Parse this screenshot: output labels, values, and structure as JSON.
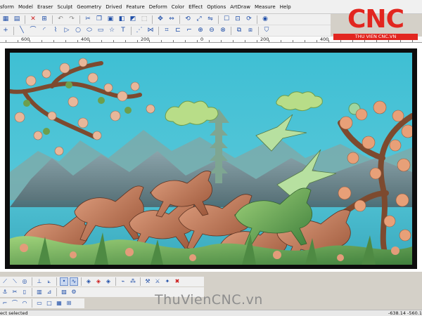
{
  "menu": [
    "sform",
    "Model",
    "Eraser",
    "Sculpt",
    "Geometry",
    "Drived",
    "Feature",
    "Deform",
    "Color",
    "Effect",
    "Options",
    "ArtDraw",
    "Measure",
    "Help"
  ],
  "toolbar1": [
    {
      "name": "open-icon",
      "glyph": "▦",
      "color": "blue"
    },
    {
      "name": "save-icon",
      "glyph": "▤",
      "color": "blue"
    },
    {
      "name": "sep"
    },
    {
      "name": "cross-icon",
      "glyph": "✕",
      "color": "red"
    },
    {
      "name": "mesh-icon",
      "glyph": "⊞",
      "color": "blue"
    },
    {
      "name": "sep"
    },
    {
      "name": "undo-icon",
      "glyph": "↶",
      "color": "grey"
    },
    {
      "name": "redo-icon",
      "glyph": "↷",
      "color": "grey"
    },
    {
      "name": "sep"
    },
    {
      "name": "cut-icon",
      "glyph": "✂",
      "color": "blue"
    },
    {
      "name": "copy-icon",
      "glyph": "❐",
      "color": "blue"
    },
    {
      "name": "paste-icon",
      "glyph": "▣",
      "color": "blue"
    },
    {
      "name": "cube-icon",
      "glyph": "◧",
      "color": "blue"
    },
    {
      "name": "shaded-icon",
      "glyph": "◩",
      "color": "blue"
    },
    {
      "name": "wire-icon",
      "glyph": "⬚",
      "color": "grey"
    },
    {
      "name": "sep"
    },
    {
      "name": "move-icon",
      "glyph": "✥",
      "color": "blue"
    },
    {
      "name": "arrows-icon",
      "glyph": "⇔",
      "color": "blue"
    },
    {
      "name": "sep"
    },
    {
      "name": "rotate-icon",
      "glyph": "⟲",
      "color": "blue"
    },
    {
      "name": "scale-icon",
      "glyph": "⤢",
      "color": "blue"
    },
    {
      "name": "mirror-icon",
      "glyph": "⇋",
      "color": "blue"
    },
    {
      "name": "sep"
    },
    {
      "name": "pan-icon",
      "glyph": "☐",
      "color": "blue"
    },
    {
      "name": "zoom-fit-icon",
      "glyph": "⊡",
      "color": "blue"
    },
    {
      "name": "reset-icon",
      "glyph": "⟳",
      "color": "blue"
    },
    {
      "name": "sep"
    },
    {
      "name": "view-icon",
      "glyph": "◉",
      "color": "blue"
    }
  ],
  "toolbar2": [
    {
      "name": "select-icon",
      "glyph": "+",
      "color": "blue"
    },
    {
      "name": "sep"
    },
    {
      "name": "line-icon",
      "glyph": "╲",
      "color": "blue"
    },
    {
      "name": "curve-icon",
      "glyph": "⌒",
      "color": "blue"
    },
    {
      "name": "arc-icon",
      "glyph": "◜",
      "color": "blue"
    },
    {
      "name": "polyline-icon",
      "glyph": "⌇",
      "color": "blue"
    },
    {
      "name": "triangle-icon",
      "glyph": "▷",
      "color": "blue"
    },
    {
      "name": "circle-icon",
      "glyph": "○",
      "color": "blue"
    },
    {
      "name": "ellipse-icon",
      "glyph": "⬭",
      "color": "blue"
    },
    {
      "name": "rectangle-icon",
      "glyph": "▭",
      "color": "blue"
    },
    {
      "name": "star-icon",
      "glyph": "☆",
      "color": "blue"
    },
    {
      "name": "text-icon",
      "glyph": "T",
      "color": "blue"
    },
    {
      "name": "sep"
    },
    {
      "name": "node-icon",
      "glyph": "⋰",
      "color": "blue"
    },
    {
      "name": "join-icon",
      "glyph": "⋈",
      "color": "blue"
    },
    {
      "name": "sep"
    },
    {
      "name": "trim-icon",
      "glyph": "⌗",
      "color": "blue"
    },
    {
      "name": "offset-icon",
      "glyph": "⊏",
      "color": "blue"
    },
    {
      "name": "fillet-icon",
      "glyph": "⌐",
      "color": "blue"
    },
    {
      "name": "weld-icon",
      "glyph": "⊕",
      "color": "blue"
    },
    {
      "name": "subtract-icon",
      "glyph": "⊖",
      "color": "blue"
    },
    {
      "name": "intersect-icon",
      "glyph": "⊗",
      "color": "blue"
    },
    {
      "name": "sep"
    },
    {
      "name": "group-icon",
      "glyph": "⧉",
      "color": "blue"
    },
    {
      "name": "ungroup-icon",
      "glyph": "⧈",
      "color": "blue"
    },
    {
      "name": "sep"
    },
    {
      "name": "shield-icon",
      "glyph": "⛉",
      "color": "blue"
    }
  ],
  "ruler_labels": [
    "600",
    "400",
    "200",
    "0",
    "200",
    "400"
  ],
  "logo": {
    "wordmark": "CNC",
    "subtitle": "THU VIEN CNC.VN"
  },
  "bottom_toolbar1": [
    {
      "name": "x-axis-icon",
      "glyph": "⟋",
      "color": "blue"
    },
    {
      "name": "y-axis-icon",
      "glyph": "⟍",
      "color": "blue"
    },
    {
      "name": "orbit-icon",
      "glyph": "◎",
      "color": "blue"
    },
    {
      "name": "sep"
    },
    {
      "name": "floor-icon",
      "glyph": "⊥",
      "color": "blue"
    },
    {
      "name": "slope-icon",
      "glyph": "⟀",
      "color": "blue"
    },
    {
      "name": "sep"
    },
    {
      "name": "point-icon",
      "glyph": "•",
      "color": "blue",
      "active": true
    },
    {
      "name": "spline-icon",
      "glyph": "∿",
      "color": "blue",
      "active": true
    },
    {
      "name": "sep"
    },
    {
      "name": "diamond-icon",
      "glyph": "◈",
      "color": "blue"
    },
    {
      "name": "diamond2-icon",
      "glyph": "◈",
      "color": "red"
    },
    {
      "name": "diamond3-icon",
      "glyph": "◈",
      "color": "blue"
    },
    {
      "name": "sep"
    },
    {
      "name": "brush-icon",
      "glyph": "⌁",
      "color": "blue"
    },
    {
      "name": "spray-icon",
      "glyph": "⁂",
      "color": "blue"
    },
    {
      "name": "sep"
    },
    {
      "name": "tools-icon",
      "glyph": "⚒",
      "color": "blue"
    },
    {
      "name": "knife-icon",
      "glyph": "⚔",
      "color": "blue"
    },
    {
      "name": "star-tool-icon",
      "glyph": "✦",
      "color": "blue"
    },
    {
      "name": "delete-icon",
      "glyph": "✖",
      "color": "red"
    }
  ],
  "bottom_toolbar2": [
    {
      "name": "anchor-icon",
      "glyph": "⚓",
      "color": "blue"
    },
    {
      "name": "scissors-icon",
      "glyph": "✂",
      "color": "blue"
    },
    {
      "name": "doc-icon",
      "glyph": "▯",
      "color": "blue"
    },
    {
      "name": "sep"
    },
    {
      "name": "trash-icon",
      "glyph": "▥",
      "color": "blue"
    },
    {
      "name": "vector-icon",
      "glyph": "⊿",
      "color": "blue"
    },
    {
      "name": "sep"
    },
    {
      "name": "cam-icon",
      "glyph": "▨",
      "color": "blue"
    },
    {
      "name": "gear-icon",
      "glyph": "⚙",
      "color": "blue"
    }
  ],
  "bottom_toolbar3": [
    {
      "name": "corner-icon",
      "glyph": "⌐",
      "color": "blue"
    },
    {
      "name": "curve-tool-icon",
      "glyph": "⌒",
      "color": "blue"
    },
    {
      "name": "arc-tool-icon",
      "glyph": "◠",
      "color": "blue"
    },
    {
      "name": "sep"
    },
    {
      "name": "rect-tool-icon",
      "glyph": "▭",
      "color": "blue"
    },
    {
      "name": "square-icon",
      "glyph": "□",
      "color": "blue"
    },
    {
      "name": "layers-icon",
      "glyph": "▦",
      "color": "blue"
    },
    {
      "name": "grid-icon",
      "glyph": "⊞",
      "color": "blue"
    }
  ],
  "watermark": "ThuVienCNC.vn",
  "status": {
    "left": "ect selected",
    "right": "-638.14 -560.1"
  }
}
